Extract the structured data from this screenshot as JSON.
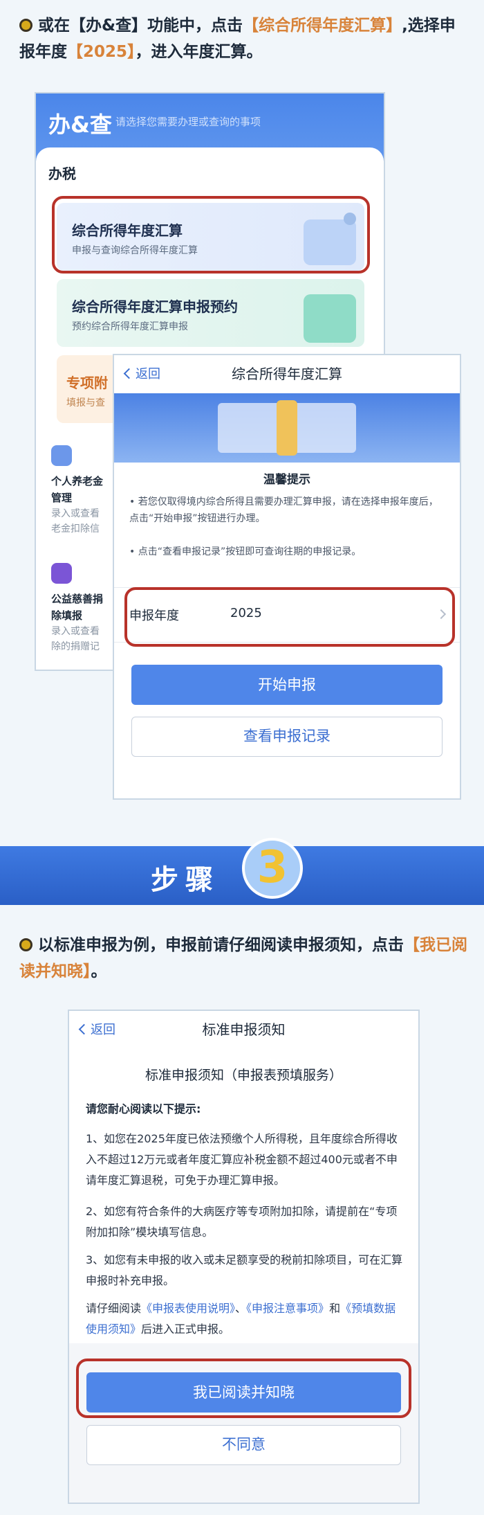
{
  "section1": {
    "instruction_pre": "或在【办&查】功能中，点击",
    "instruction_hl1": "【综合所得年度汇算】",
    "instruction_mid": ",选择申报年度",
    "instruction_hl2": "【2025】",
    "instruction_post": "，进入年度汇算。"
  },
  "ban_cha": {
    "title": "办&查",
    "search_placeholder": "请选择您需要办理或查询的事项",
    "category": "办税",
    "cards": [
      {
        "title": "综合所得年度汇算",
        "subtitle": "申报与查询综合所得年度汇算"
      },
      {
        "title": "综合所得年度汇算申报预约",
        "subtitle": "预约综合所得年度汇算申报"
      },
      {
        "title": "专项附",
        "subtitle": "填报与查"
      }
    ],
    "side_items": [
      {
        "title": "个人养老金",
        "title2": "管理",
        "desc1": "录入或查看",
        "desc2": "老金扣除信"
      },
      {
        "title": "公益慈善捐",
        "title2": "除填报",
        "desc1": "录入或查看",
        "desc2": "除的捐赠记"
      }
    ]
  },
  "annual_calc": {
    "back": "返回",
    "title": "综合所得年度汇算",
    "notice_title": "温馨提示",
    "notice1": "若您仅取得境内综合所得且需要办理汇算申报，请在选择申报年度后，点击“开始申报”按钮进行办理。",
    "notice2": "点击“查看申报记录”按钮即可查询往期的申报记录。",
    "year_label": "申报年度",
    "year_value": "2025",
    "start_button": "开始申报",
    "records_button": "查看申报记录"
  },
  "step": {
    "label": "步骤",
    "number": "3"
  },
  "section3": {
    "instruction_pre": "以标准申报为例，申报前请仔细阅读申报须知，点击",
    "instruction_hl": "【我已阅读并知晓】",
    "instruction_post": "。"
  },
  "notice": {
    "back": "返回",
    "title": "标准申报须知",
    "heading": "标准申报须知（申报表预填服务）",
    "lead": "请您耐心阅读以下提示:",
    "p1": "1、如您在2025年度已依法预缴个人所得税，且年度综合所得收入不超过12万元或者年度汇算应补税金额不超过400元或者不申请年度汇算退税，可免于办理汇算申报。",
    "p2": "2、如您有符合条件的大病医疗等专项附加扣除，请提前在“专项附加扣除”模块填写信息。",
    "p3": "3、如您有未申报的收入或未足额享受的税前扣除项目，可在汇算申报时补充申报。",
    "p4_pre": "请仔细阅读",
    "link1": "《申报表使用说明》",
    "sep": "、",
    "link2": "《申报注意事项》",
    "and": "和",
    "link3": "《预填数据使用须知》",
    "p4_post": "后进入正式申报。",
    "agree_button": "我已阅读并知晓",
    "disagree_button": "不同意"
  }
}
